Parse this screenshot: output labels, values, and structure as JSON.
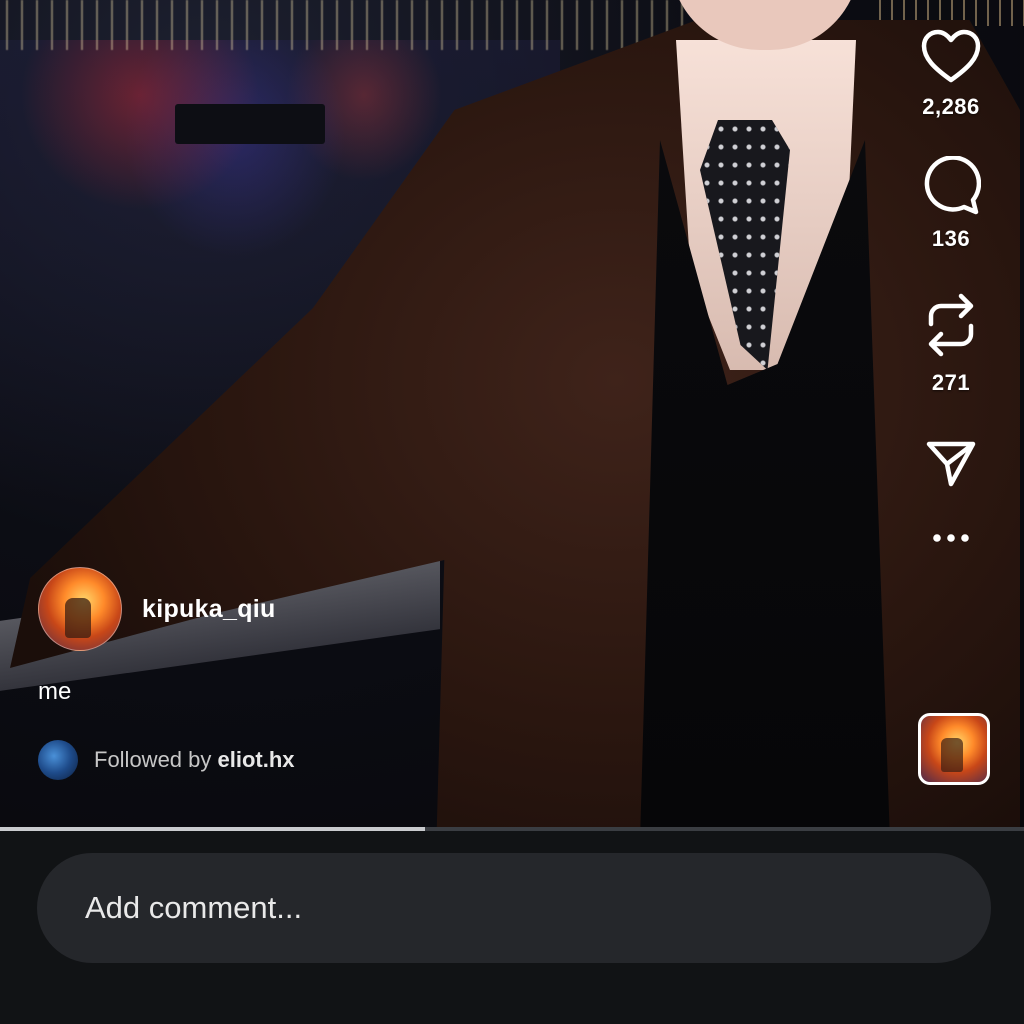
{
  "post": {
    "username": "kipuka_qiu",
    "caption": "me",
    "followed_prefix": "Followed by ",
    "followed_user": "eliot.hx"
  },
  "actions": {
    "likes": "2,286",
    "comments": "136",
    "reposts": "271"
  },
  "playback": {
    "progress_percent": 41.5
  },
  "comment_bar": {
    "placeholder": "Add comment..."
  },
  "icons": [
    "heart-icon",
    "comment-bubble-icon",
    "repost-icon",
    "send-icon",
    "more-icon"
  ],
  "colors": {
    "background": "#111315",
    "comment_field": "#25272b",
    "progress_fill": "#c9cbce"
  }
}
